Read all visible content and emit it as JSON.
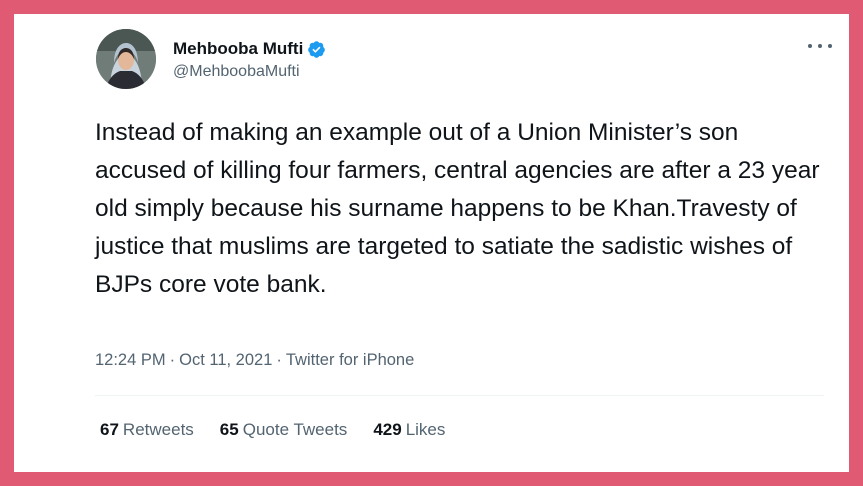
{
  "colors": {
    "background_frame": "#e05a73",
    "card": "#ffffff",
    "text_primary": "#0f1419",
    "text_secondary": "#536471",
    "verified_badge": "#1d9bf0"
  },
  "author": {
    "display_name": "Mehbooba Mufti",
    "handle": "@MehboobaMufti",
    "verified": true,
    "avatar_icon": "user-avatar"
  },
  "tweet": {
    "text": "Instead of making an example out of a Union Minister’s son accused of killing four farmers, central agencies are after a 23 year old simply because his surname happens to be Khan.Travesty of justice that muslims are targeted to satiate the sadistic wishes of BJPs core vote bank.",
    "time": "12:24 PM",
    "separator": "·",
    "date": "Oct 11, 2021",
    "source": "Twitter for iPhone"
  },
  "stats": {
    "retweets_count": "67",
    "retweets_label": "Retweets",
    "quotes_count": "65",
    "quotes_label": "Quote Tweets",
    "likes_count": "429",
    "likes_label": "Likes"
  },
  "icons": {
    "more": "more-options-icon",
    "verified": "verified-badge-icon"
  }
}
